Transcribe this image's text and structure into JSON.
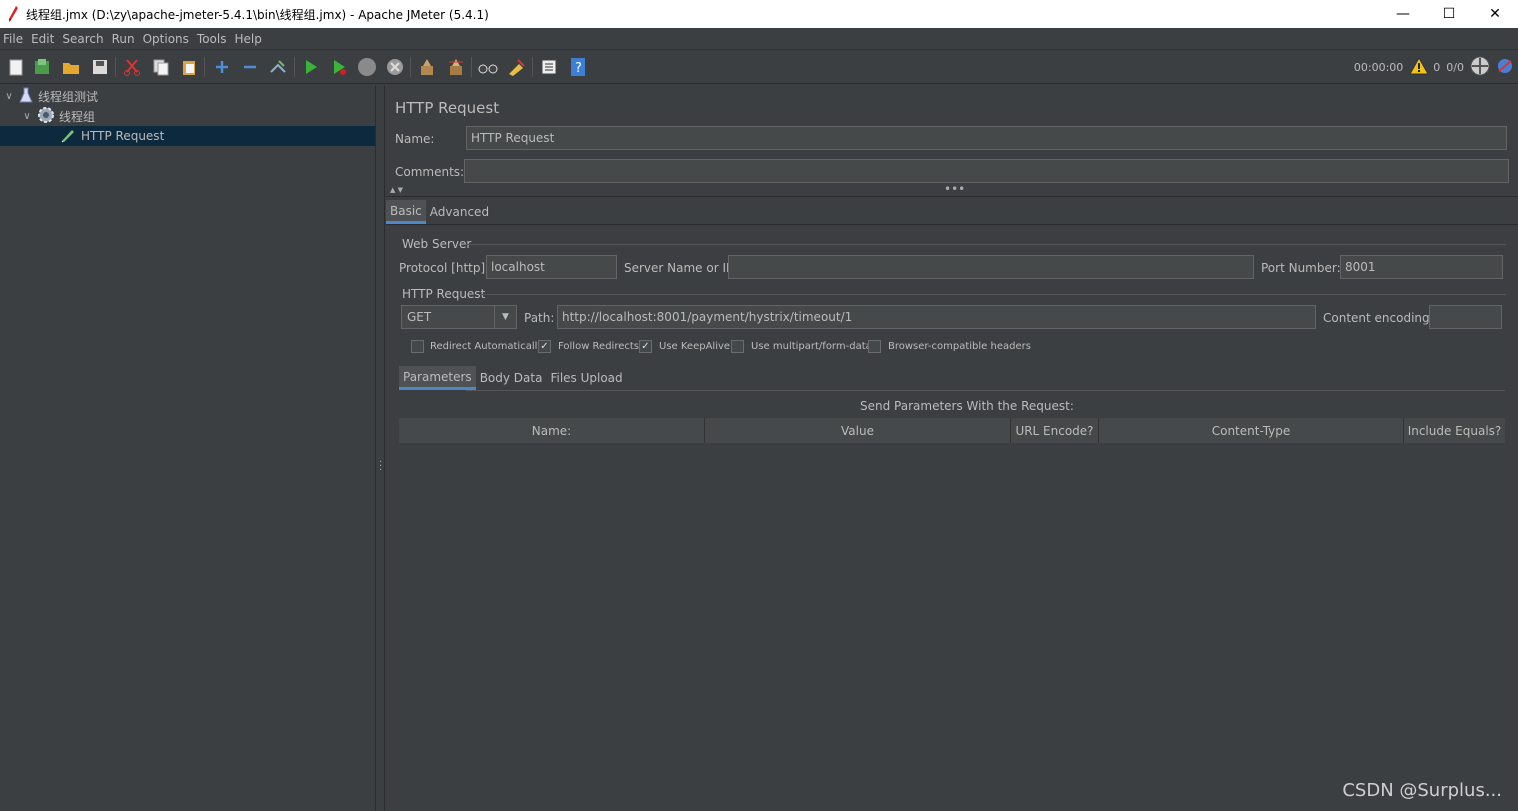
{
  "window": {
    "title": "线程组.jmx (D:\\zy\\apache-jmeter-5.4.1\\bin\\线程组.jmx) - Apache JMeter (5.4.1)",
    "minimize": "—",
    "maximize": "☐",
    "close": "✕"
  },
  "menu": [
    "File",
    "Edit",
    "Search",
    "Run",
    "Options",
    "Tools",
    "Help"
  ],
  "toolbar": {
    "timer": "00:00:00",
    "warnings": "0",
    "threads": "0/0"
  },
  "tree": {
    "items": [
      {
        "label": "线程组测试",
        "icon": "flask-icon"
      },
      {
        "label": "线程组",
        "icon": "gear-icon"
      },
      {
        "label": "HTTP Request",
        "icon": "pen-icon",
        "selected": true
      }
    ]
  },
  "panel": {
    "heading": "HTTP Request",
    "name_label": "Name:",
    "name_value": "HTTP Request",
    "comments_label": "Comments:",
    "comments_value": "",
    "tabs": [
      "Basic",
      "Advanced"
    ],
    "web_server": {
      "title": "Web Server",
      "protocol_label": "Protocol [http]:",
      "protocol_value": "localhost",
      "server_label": "Server Name or IP:",
      "server_value": "",
      "port_label": "Port Number:",
      "port_value": "8001"
    },
    "http_request": {
      "title": "HTTP Request",
      "method": "GET",
      "path_label": "Path:",
      "path_value": "http://localhost:8001/payment/hystrix/timeout/1",
      "encoding_label": "Content encoding:",
      "encoding_value": ""
    },
    "options": [
      {
        "label": "Redirect Automatically",
        "checked": false
      },
      {
        "label": "Follow Redirects",
        "checked": true
      },
      {
        "label": "Use KeepAlive",
        "checked": true
      },
      {
        "label": "Use multipart/form-data",
        "checked": false
      },
      {
        "label": "Browser-compatible headers",
        "checked": false
      }
    ],
    "sub_tabs": [
      "Parameters",
      "Body Data",
      "Files Upload"
    ],
    "params_caption": "Send Parameters With the Request:",
    "columns": [
      "Name:",
      "Value",
      "URL Encode?",
      "Content-Type",
      "Include Equals?"
    ]
  },
  "watermark": "CSDN @Surplus..."
}
